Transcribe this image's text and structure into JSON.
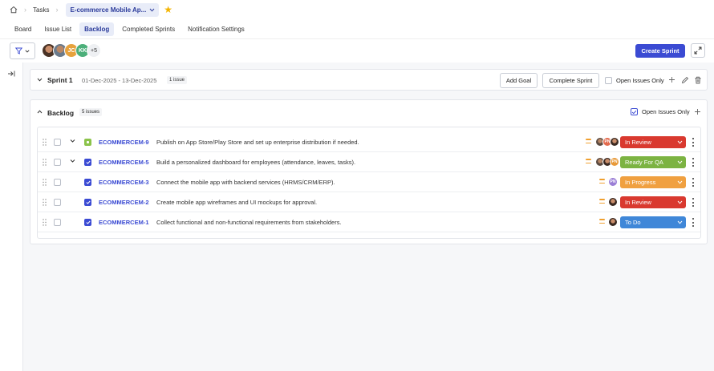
{
  "breadcrumb": {
    "tasks": "Tasks",
    "project": "E-commerce Mobile Ap..."
  },
  "tabs": [
    {
      "label": "Board",
      "active": false
    },
    {
      "label": "Issue List",
      "active": false
    },
    {
      "label": "Backlog",
      "active": true
    },
    {
      "label": "Completed Sprints",
      "active": false
    },
    {
      "label": "Notification Settings",
      "active": false
    }
  ],
  "toolbar": {
    "avatars": [
      "",
      "",
      "JC",
      "KK"
    ],
    "more_count": "+5",
    "create_sprint": "Create Sprint"
  },
  "sprint": {
    "title": "Sprint 1",
    "dates": "01-Dec-2025 - 13-Dec-2025",
    "issue_count": "1 issue",
    "add_goal": "Add Goal",
    "complete_sprint": "Complete Sprint",
    "open_only": "Open Issues Only",
    "open_only_checked": false
  },
  "backlog": {
    "title": "Backlog",
    "issue_count": "5 issues",
    "open_only": "Open Issues Only",
    "open_only_checked": true,
    "rows": [
      {
        "key": "ECOMMERCEM-9",
        "type": "story",
        "summary": "Publish on App Store/Play Store and set up enterprise distribution if needed.",
        "assignees": [
          "",
          "PN",
          ""
        ],
        "status": "In Review",
        "status_color": "#d9392f",
        "expandable": true,
        "priority": "medium"
      },
      {
        "key": "ECOMMERCEM-5",
        "type": "task",
        "summary": "Build a personalized dashboard for employees (attendance, leaves, tasks).",
        "assignees": [
          "",
          "",
          "PN"
        ],
        "status": "Ready For QA",
        "status_color": "#7cb342",
        "expandable": true,
        "priority": "medium"
      },
      {
        "key": "ECOMMERCEM-3",
        "type": "task",
        "summary": "Connect the mobile app with backend services (HRMS/CRM/ERP).",
        "assignees": [
          "PN"
        ],
        "status": "In Progress",
        "status_color": "#f0a040",
        "expandable": false,
        "priority": "medium"
      },
      {
        "key": "ECOMMERCEM-2",
        "type": "task",
        "summary": "Create mobile app wireframes and UI mockups for approval.",
        "assignees": [
          ""
        ],
        "status": "In Review",
        "status_color": "#d9392f",
        "expandable": false,
        "priority": "medium"
      },
      {
        "key": "ECOMMERCEM-1",
        "type": "task",
        "summary": "Collect functional and non-functional requirements from stakeholders.",
        "assignees": [
          ""
        ],
        "status": "To Do",
        "status_color": "#3f87d8",
        "expandable": false,
        "priority": "medium"
      }
    ]
  },
  "colors": {
    "accent": "#3b4bd3",
    "star": "#f4b400",
    "priority": "#f0a030"
  },
  "icons": [
    "home-icon",
    "chevron-right-icon",
    "chevron-down-icon",
    "star-icon",
    "filter-icon",
    "expand-icon",
    "collapse-sidebar-icon",
    "plus-icon",
    "edit-icon",
    "trash-icon",
    "drag-handle-icon",
    "more-vertical-icon"
  ]
}
